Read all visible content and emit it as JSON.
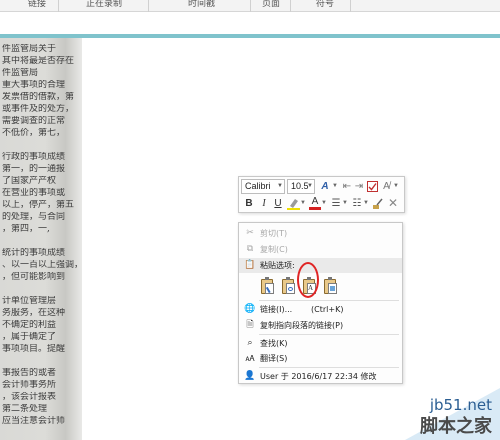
{
  "ribbon": {
    "items": [
      {
        "label": "链接"
      },
      {
        "label": "正在录制"
      },
      {
        "label": "时间戳"
      },
      {
        "label": "页面"
      },
      {
        "label": "符号"
      }
    ]
  },
  "document_snippet": {
    "lines": [
      "件监管局关于",
      "其中将最是否存在",
      "件监管局",
      "重大事项的合理",
      "发票借的借款，第",
      "或事件及的处方，",
      "需要调查的正常",
      "不低价，第七，",
      "",
      "行政的事项成绩",
      "第一，的一通报",
      "了国家产产权",
      "在营业的事项或",
      "以上，停产，第五",
      "的处理，与合同",
      "，第四，一,",
      "",
      "统计的事项成绩",
      "、以一百以上强调，",
      "，但可能影响到",
      "",
      "计单位管理层",
      "务服务，在这种",
      "不确定的利益",
      "，属于确定了",
      "事项项目。提醒",
      "",
      "事报告的或者",
      "会计师事务所",
      "，该会计报表",
      "第二条处理",
      "应当注意会计师"
    ]
  },
  "mini_toolbar": {
    "font_name": "Calibri",
    "font_size": "10.5",
    "grow_font": "A",
    "bold": "B",
    "italic": "I",
    "underline": "U",
    "font_color": "A"
  },
  "context_menu": {
    "items": [
      {
        "label": "剪切(T)",
        "enabled": false
      },
      {
        "label": "复制(C)",
        "enabled": false
      },
      {
        "label": "粘贴选项:",
        "enabled": true
      },
      {
        "label": "链接(I)...",
        "shortcut": "Ctrl+K",
        "enabled": true
      },
      {
        "label": "复制指向段落的链接(P)",
        "enabled": true
      },
      {
        "label": "查找(K)",
        "enabled": true
      },
      {
        "label": "翻译(S)",
        "enabled": true
      },
      {
        "label": "User 于 2016/6/17 22:34 修改",
        "enabled": true
      }
    ],
    "paste_options": {
      "icons": [
        {
          "icon": "paste-keep-source-formatting-icon"
        },
        {
          "icon": "paste-merge-formatting-icon"
        },
        {
          "icon": "paste-keep-text-only-icon",
          "glyph": "A",
          "highlighted": true
        },
        {
          "icon": "paste-picture-icon"
        }
      ]
    }
  },
  "watermark": {
    "site": "jb51.net",
    "brand": "脚本之家"
  },
  "colors": {
    "accent_line": "#7fc3cc",
    "highlight_ring": "#e02525",
    "watermark_blue": "#2a5d92"
  }
}
